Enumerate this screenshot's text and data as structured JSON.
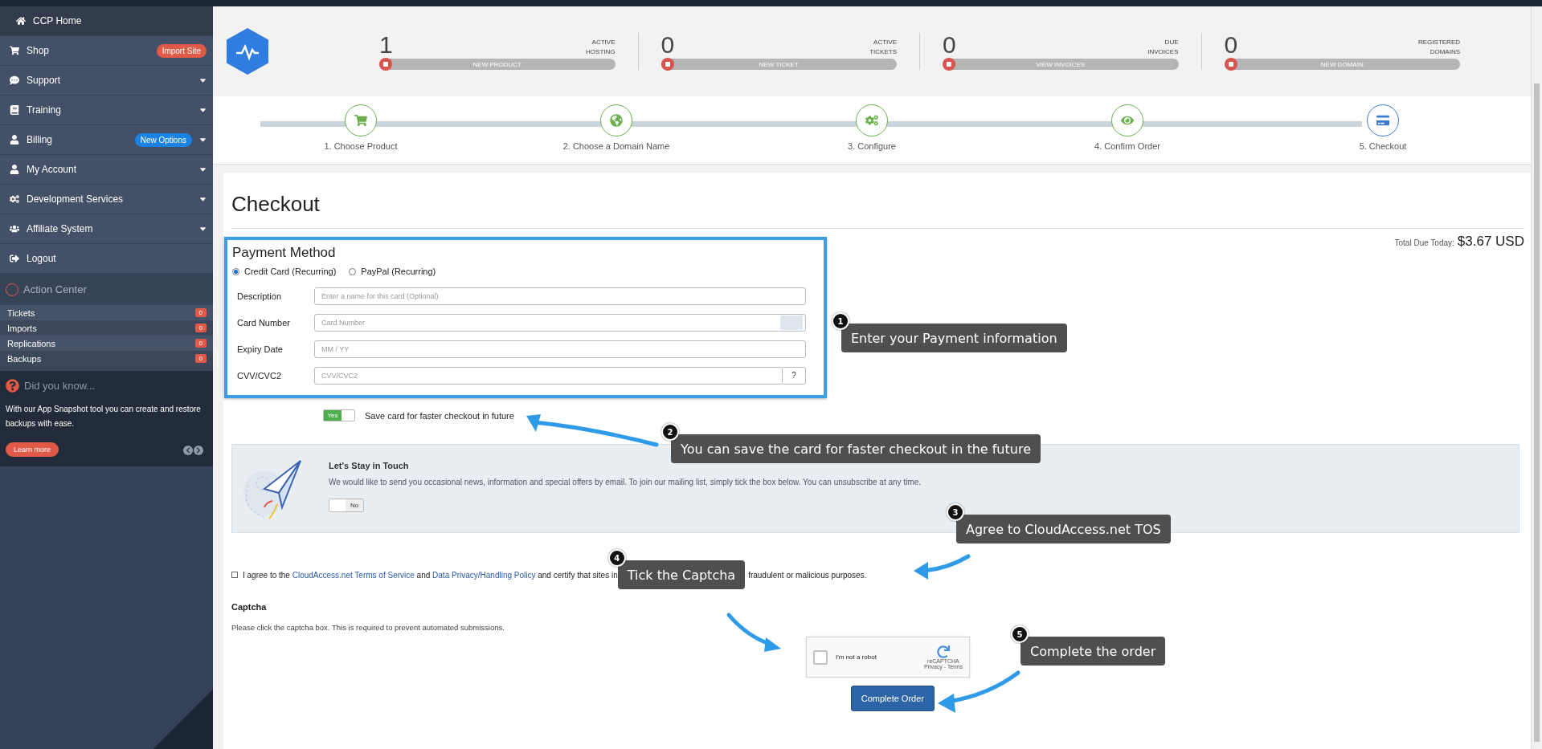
{
  "sidebar": {
    "items": [
      {
        "label": "CCP Home",
        "caret": false,
        "selected": true
      },
      {
        "label": "Shop",
        "caret": false,
        "selected": false,
        "badge": {
          "text": "Import Site",
          "color": "#e05a47"
        }
      },
      {
        "label": "Support",
        "caret": true,
        "selected": false
      },
      {
        "label": "Training",
        "caret": true,
        "selected": false
      },
      {
        "label": "Billing",
        "caret": true,
        "selected": false,
        "badge": {
          "text": "New Options",
          "color": "#1a82e2"
        }
      },
      {
        "label": "My Account",
        "caret": true,
        "selected": false
      },
      {
        "label": "Development Services",
        "caret": true,
        "selected": false
      },
      {
        "label": "Affiliate System",
        "caret": true,
        "selected": false
      },
      {
        "label": "Logout",
        "caret": false,
        "selected": false
      }
    ],
    "action_center": {
      "title": "Action Center",
      "counters": [
        {
          "label": "Tickets",
          "count": "0"
        },
        {
          "label": "Imports",
          "count": "0"
        },
        {
          "label": "Replications",
          "count": "0"
        },
        {
          "label": "Backups",
          "count": "0"
        }
      ]
    },
    "tip": {
      "title": "Did you know...",
      "text": "With our App Snapshot tool you can create and restore backups with ease.",
      "button": "Learn more"
    }
  },
  "stats": [
    {
      "value": "1",
      "label": [
        "ACTIVE",
        "HOSTING"
      ],
      "action": "NEW PRODUCT"
    },
    {
      "value": "0",
      "label": [
        "ACTIVE",
        "TICKETS"
      ],
      "action": "NEW TICKET"
    },
    {
      "value": "0",
      "label": [
        "DUE",
        "INVOICES"
      ],
      "action": "VIEW INVOICES"
    },
    {
      "value": "0",
      "label": [
        "REGISTERED",
        "DOMAINS"
      ],
      "action": "NEW DOMAIN"
    }
  ],
  "steps": [
    {
      "label": "1. Choose Product",
      "completed": true
    },
    {
      "label": "2. Choose a Domain Name",
      "completed": true
    },
    {
      "label": "3. Configure",
      "completed": true
    },
    {
      "label": "4. Confirm Order",
      "completed": true
    },
    {
      "label": "5. Checkout",
      "completed": false
    }
  ],
  "checkout": {
    "title": "Checkout",
    "total_label": "Total Due Today:",
    "total": "$3.67 USD",
    "payment": {
      "title": "Payment Method",
      "methods": [
        {
          "label": "Credit Card (Recurring)",
          "selected": true
        },
        {
          "label": "PayPal (Recurring)",
          "selected": false
        }
      ],
      "fields": [
        {
          "label": "Description",
          "placeholder": "Enter a name for this card (Optional)",
          "kind": "plain"
        },
        {
          "label": "Card Number",
          "placeholder": "Card Number",
          "kind": "card"
        },
        {
          "label": "Expiry Date",
          "placeholder": "MM / YY",
          "kind": "plain"
        },
        {
          "label": "CVV/CVC2",
          "placeholder": "CVV/CVC2",
          "kind": "help",
          "addon": "?"
        }
      ]
    },
    "save_card": {
      "on": true,
      "switch_text": "Yes",
      "label": "Save card for faster checkout in future"
    },
    "newsletter": {
      "title": "Let's Stay in Touch",
      "text": "We would like to send you occasional news, information and special offers by email. To join our mailing list, simply tick the box below. You can unsubscribe at any time.",
      "on": false,
      "switch_text": "No"
    },
    "agree": {
      "checked": false,
      "parts": [
        {
          "text": "I agree to the ",
          "link": false
        },
        {
          "text": "CloudAccess.net Terms of Service",
          "link": true
        },
        {
          "text": " and ",
          "link": false
        },
        {
          "text": "Data Privacy/Handling Policy",
          "link": true
        },
        {
          "text": " and certify that sites in",
          "link": false
        }
      ],
      "tail": "fraudulent or malicious purposes."
    },
    "captcha": {
      "title": "Captcha",
      "text": "Please click the captcha box. This is required to prevent automated submissions.",
      "checkbox_label": "I'm not a robot",
      "brand": "reCAPTCHA",
      "links": "Privacy - Terms",
      "checked": false
    },
    "submit": "Complete Order"
  },
  "callouts": [
    {
      "number": "1",
      "text": "Enter your Payment information"
    },
    {
      "number": "2",
      "text": "You can save the card for faster checkout in the future"
    },
    {
      "number": "3",
      "text": "Agree to CloudAccess.net TOS"
    },
    {
      "number": "4",
      "text": "Tick the Captcha"
    },
    {
      "number": "5",
      "text": "Complete the order"
    }
  ]
}
